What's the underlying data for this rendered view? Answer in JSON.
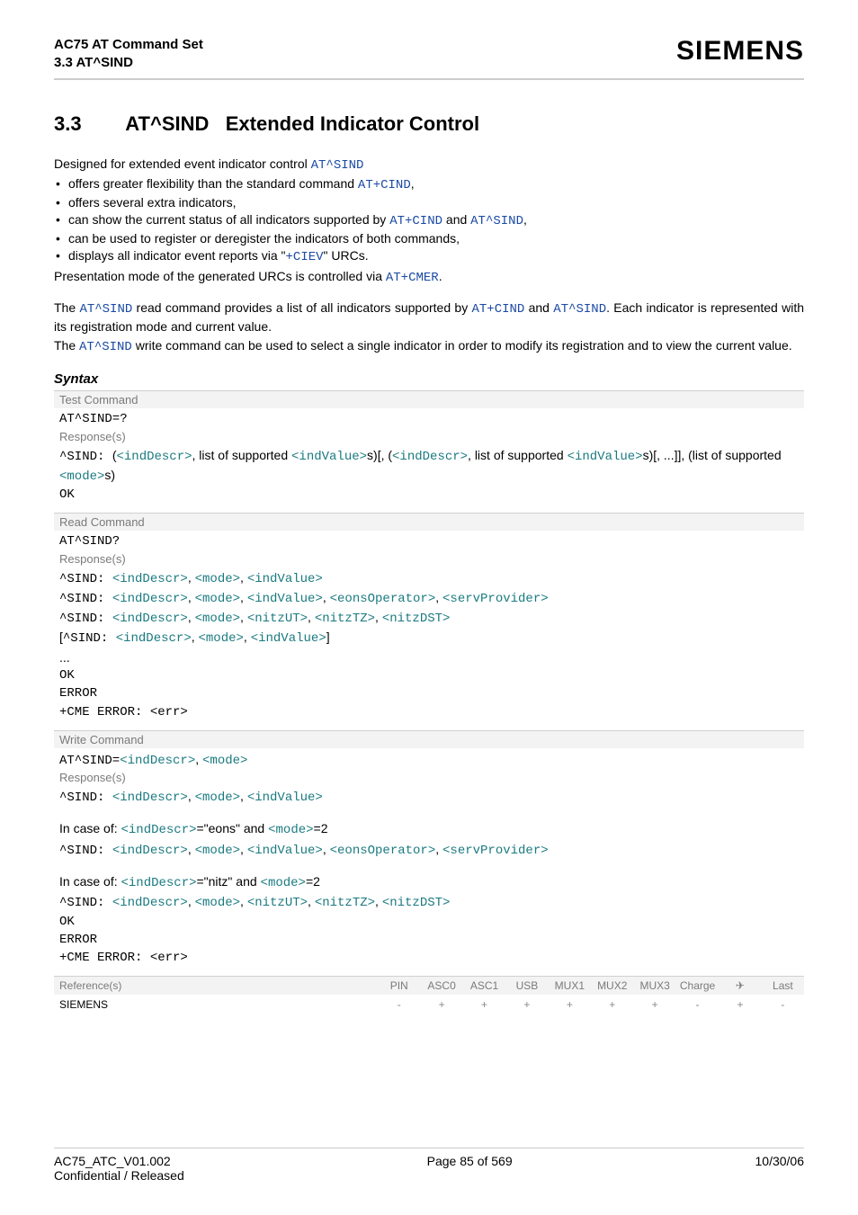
{
  "header": {
    "title": "AC75 AT Command Set",
    "subtitle": "3.3 AT^SIND",
    "logo": "SIEMENS"
  },
  "section": {
    "number": "3.3",
    "cmd": "AT^SIND",
    "title": "Extended Indicator Control"
  },
  "intro": {
    "lead_pre": "Designed for extended event indicator control ",
    "lead_cmd": "AT^SIND",
    "bullets": [
      {
        "pre": "offers greater flexibility than the standard command ",
        "c1": "AT+CIND",
        "post": ","
      },
      {
        "pre": "offers several extra indicators,"
      },
      {
        "pre": "can show the current status of all indicators supported by ",
        "c1": "AT+CIND",
        "mid": " and ",
        "c2": "AT^SIND",
        "post": ","
      },
      {
        "pre": "can be used to register or deregister the indicators of both commands,"
      },
      {
        "pre": "displays all indicator event reports via \"",
        "c1": "+CIEV",
        "post": "\" URCs."
      }
    ],
    "pres_pre": "Presentation mode of the generated URCs is controlled via ",
    "pres_cmd": "AT+CMER",
    "pres_post": ".",
    "p2_a": "The ",
    "p2_cmd1": "AT^SIND",
    "p2_b": " read command provides a list of all indicators supported by ",
    "p2_cmd2": "AT+CIND",
    "p2_c": " and ",
    "p2_cmd3": "AT^SIND",
    "p2_d": ". Each indicator is represented with its registration mode and current value.",
    "p3_a": "The ",
    "p3_cmd": "AT^SIND",
    "p3_b": " write command can be used to select a single indicator in order to modify its registration and to view the current value."
  },
  "syntax": {
    "heading": "Syntax",
    "test": {
      "label": "Test Command",
      "cmd": "AT^SIND=?",
      "resp_label": "Response(s)",
      "l1_a": "^SIND: ",
      "l1_b": "(",
      "l1_p1": "<indDescr>",
      "l1_c": ", list of supported ",
      "l1_p2": "<indValue>",
      "l1_d": "s)[, (",
      "l1_p3": "<indDescr>",
      "l1_e": ", list of supported ",
      "l1_p4": "<indValue>",
      "l1_f": "s)[, ...]], (list of supported ",
      "l1_p5": "<mode>",
      "l1_g": "s)",
      "ok": "OK"
    },
    "read": {
      "label": "Read Command",
      "cmd": "AT^SIND?",
      "resp_label": "Response(s)",
      "s": "^SIND: ",
      "p": {
        "indDescr": "<indDescr>",
        "mode": "<mode>",
        "indValue": "<indValue>",
        "eonsOperator": "<eonsOperator>",
        "servProvider": "<servProvider>",
        "nitzUT": "<nitzUT>",
        "nitzTZ": "<nitzTZ>",
        "nitzDST": "<nitzDST>"
      },
      "lbrk": "[",
      "rbrk": "]",
      "dots": "...",
      "ok": "OK",
      "error": "ERROR",
      "cme": "+CME ERROR: <err>"
    },
    "write": {
      "label": "Write Command",
      "cmd_pre": "AT^SIND=",
      "resp_label": "Response(s)",
      "s": "^SIND: ",
      "case1_pre": "In case of: ",
      "case1_p1": "<indDescr>",
      "case1_mid": "=\"eons\" and ",
      "case1_p2": "<mode>",
      "case1_post": "=2",
      "case2_pre": "In case of: ",
      "case2_p1": "<indDescr>",
      "case2_mid": "=\"nitz\" and ",
      "case2_p2": "<mode>",
      "case2_post": "=2",
      "ok": "OK",
      "error": "ERROR",
      "cme": "+CME ERROR: <err>"
    },
    "ref": {
      "label": "Reference(s)",
      "vendor": "SIEMENS",
      "cols": [
        "PIN",
        "ASC0",
        "ASC1",
        "USB",
        "MUX1",
        "MUX2",
        "MUX3",
        "Charge",
        "✈",
        "Last"
      ],
      "vals": [
        "-",
        "+",
        "+",
        "+",
        "+",
        "+",
        "+",
        "-",
        "+",
        "-"
      ]
    }
  },
  "footer": {
    "left1": "AC75_ATC_V01.002",
    "left2": "Confidential / Released",
    "center": "Page 85 of 569",
    "right": "10/30/06"
  }
}
